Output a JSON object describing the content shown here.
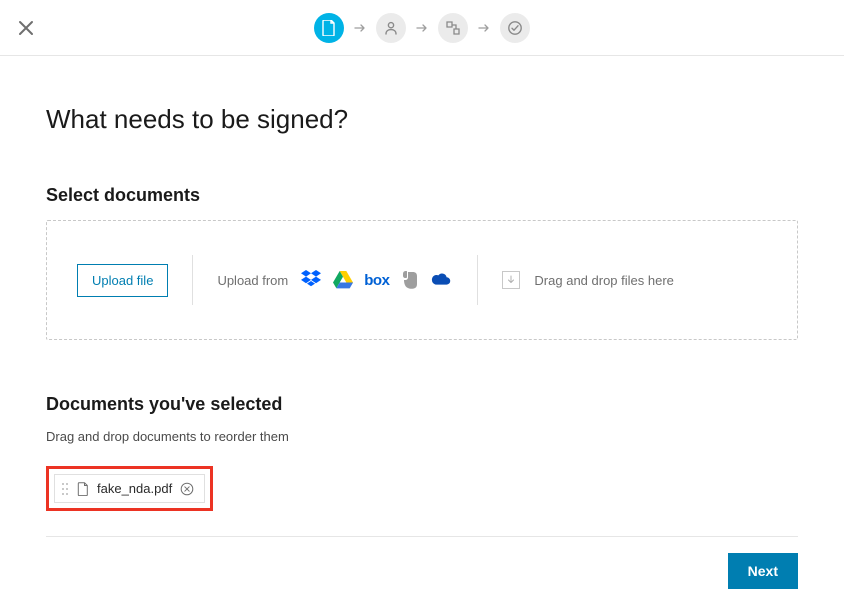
{
  "stepper": {
    "steps": [
      {
        "name": "document",
        "active": true
      },
      {
        "name": "person",
        "active": false
      },
      {
        "name": "sign",
        "active": false
      },
      {
        "name": "review",
        "active": false
      }
    ]
  },
  "page": {
    "title": "What needs to be signed?"
  },
  "select": {
    "title": "Select documents",
    "upload_button": "Upload file",
    "upload_from_label": "Upload from",
    "providers": [
      {
        "name": "dropbox"
      },
      {
        "name": "google-drive"
      },
      {
        "name": "box",
        "text": "box"
      },
      {
        "name": "evernote"
      },
      {
        "name": "onedrive"
      }
    ],
    "dnd_text": "Drag and drop files here"
  },
  "selected": {
    "title": "Documents you've selected",
    "hint": "Drag and drop documents to reorder them",
    "docs": [
      {
        "filename": "fake_nda.pdf"
      }
    ]
  },
  "footer": {
    "next_label": "Next"
  }
}
